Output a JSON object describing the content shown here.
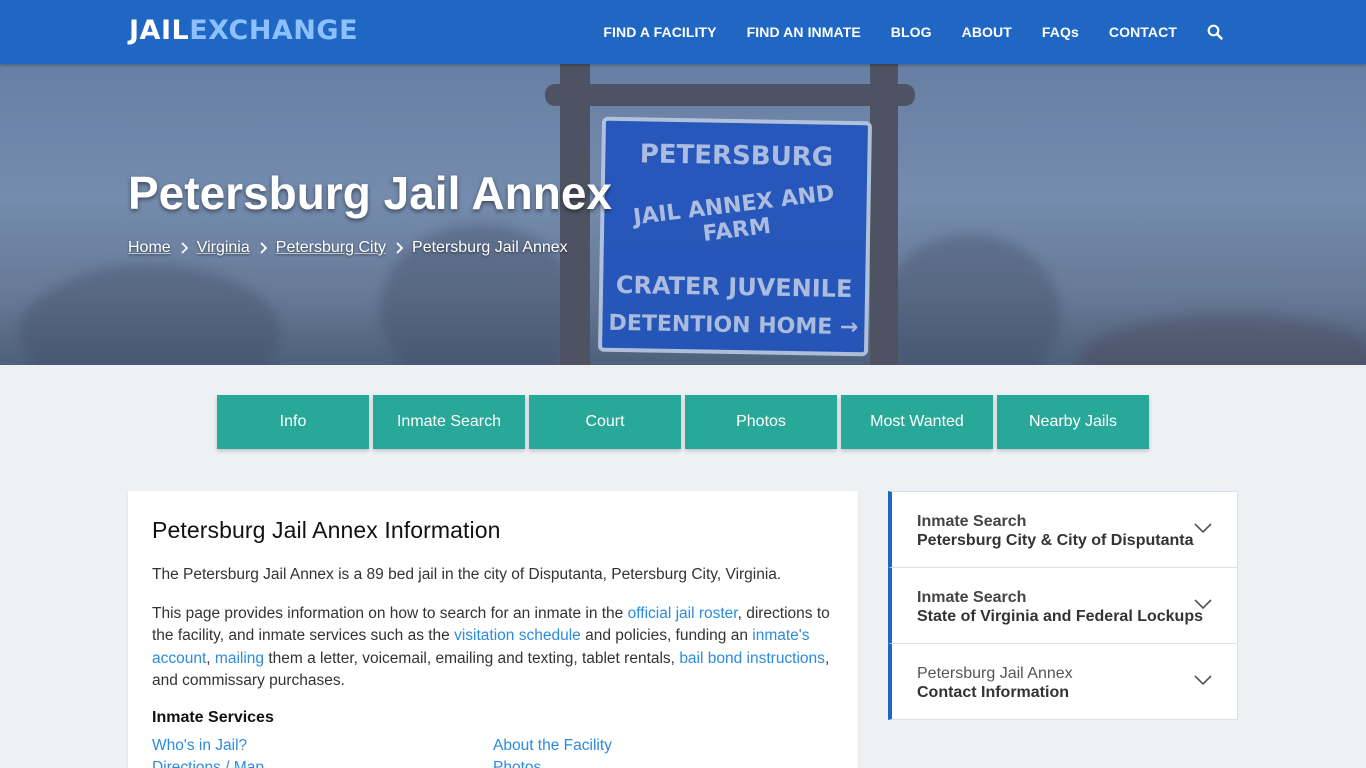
{
  "brand": {
    "part1": "JAIL",
    "part2": "EXCHANGE"
  },
  "nav": {
    "items": [
      "FIND A FACILITY",
      "FIND AN INMATE",
      "BLOG",
      "ABOUT",
      "FAQs",
      "CONTACT"
    ],
    "search_icon": "search-icon"
  },
  "hero": {
    "title": "Petersburg Jail Annex",
    "sign_text": [
      "PETERSBURG",
      "JAIL ANNEX AND FARM",
      "CRATER   JUVENILE",
      "DETENTION HOME →"
    ],
    "breadcrumbs": [
      "Home",
      "Virginia",
      "Petersburg City",
      "Petersburg Jail Annex"
    ]
  },
  "tabs": [
    "Info",
    "Inmate Search",
    "Court",
    "Photos",
    "Most Wanted",
    "Nearby Jails"
  ],
  "main": {
    "heading": "Petersburg Jail Annex Information",
    "intro": "The Petersburg Jail Annex is a 89 bed jail in the city of Disputanta, Petersburg City, Virginia.",
    "p2": {
      "t1": "This page provides information on how to search for an inmate in the ",
      "l1": "official jail roster",
      "t2": ", directions to the facility, and inmate services such as the ",
      "l2": "visitation schedule",
      "t3": " and policies, funding an ",
      "l3": "inmate's account",
      "t4": ", ",
      "l4": "mailing",
      "t5": " them a letter, voicemail, emailing and texting, tablet rentals, ",
      "l5": "bail bond instructions",
      "t6": ", and commissary purchases."
    },
    "services_heading": "Inmate Services",
    "services": [
      "Who's in Jail?",
      "About the Facility",
      "Directions / Map",
      "Photos"
    ]
  },
  "sidebar": [
    {
      "line1": "Inmate Search",
      "line2": "Petersburg City & City of Disputanta"
    },
    {
      "line1": "Inmate Search",
      "line2": "State of Virginia and Federal Lockups"
    },
    {
      "line1": "Petersburg Jail Annex",
      "line2": "Contact Information"
    }
  ],
  "colors": {
    "nav_bg": "#1f67c3",
    "tab_bg": "#28a899",
    "link": "#2b8be0"
  }
}
